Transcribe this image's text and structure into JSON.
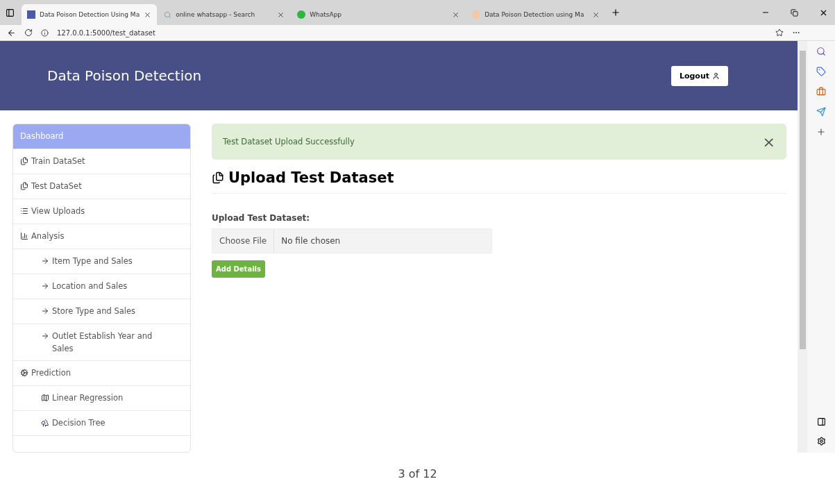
{
  "browser": {
    "tabs": [
      {
        "title": "Data Poison Detection Using Ma",
        "selected": true,
        "kind": "app"
      },
      {
        "title": "online whatsapp - Search",
        "selected": false,
        "kind": "search"
      },
      {
        "title": "WhatsApp",
        "selected": false,
        "kind": "chat"
      },
      {
        "title": "Data Poison Detection using Ma",
        "selected": false,
        "kind": "app2"
      }
    ],
    "address": "127.0.0.1:5000/test_dataset"
  },
  "header": {
    "title": "Data Poison Detection",
    "logout": "Logout"
  },
  "sidebar": {
    "items": [
      {
        "label": "Dashboard",
        "selected": true
      },
      {
        "label": "Train DataSet",
        "selected": false
      },
      {
        "label": "Test DataSet",
        "selected": false
      },
      {
        "label": "View Uploads",
        "selected": false
      },
      {
        "label": "Analysis",
        "selected": false,
        "children": [
          {
            "label": "Item Type and Sales"
          },
          {
            "label": "Location and Sales"
          },
          {
            "label": "Store Type and Sales"
          },
          {
            "label": "Outlet Establish Year and Sales"
          }
        ]
      },
      {
        "label": "Prediction",
        "selected": false,
        "children": [
          {
            "label": "Linear Regression"
          },
          {
            "label": "Decision Tree"
          }
        ]
      }
    ]
  },
  "alert": {
    "message": "Test Dataset Upload Successfully",
    "close": "×"
  },
  "page": {
    "heading": "Upload Test Dataset",
    "field_label": "Upload Test Dataset:",
    "choose": "Choose File",
    "file_status": "No file chosen",
    "submit": "Add Details"
  },
  "pager": "3 of 12"
}
